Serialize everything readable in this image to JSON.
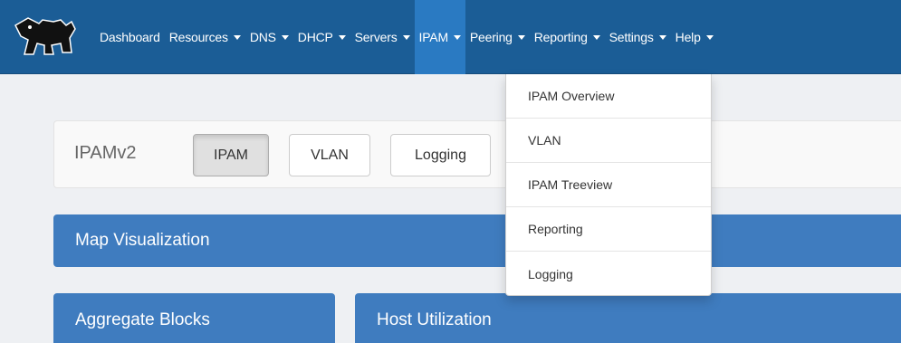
{
  "nav": {
    "items": [
      {
        "label": "Dashboard",
        "dropdown": false
      },
      {
        "label": "Resources",
        "dropdown": true
      },
      {
        "label": "DNS",
        "dropdown": true
      },
      {
        "label": "DHCP",
        "dropdown": true
      },
      {
        "label": "Servers",
        "dropdown": true
      },
      {
        "label": "IPAM",
        "dropdown": true,
        "active": true
      },
      {
        "label": "Peering",
        "dropdown": true
      },
      {
        "label": "Reporting",
        "dropdown": true
      },
      {
        "label": "Settings",
        "dropdown": true
      },
      {
        "label": "Help",
        "dropdown": true
      }
    ]
  },
  "subnav": {
    "title": "IPAMv2",
    "buttons": [
      "IPAM",
      "VLAN",
      "Logging"
    ]
  },
  "panels": {
    "map": "Map Visualization",
    "aggregate": "Aggregate Blocks",
    "host": "Host Utilization"
  },
  "ipam_menu": {
    "items": [
      "IPAM Overview",
      "VLAN",
      "IPAM Treeview",
      "Reporting",
      "Logging"
    ]
  },
  "colors": {
    "navbar": "#1b5d96",
    "nav_active": "#2a7ac2",
    "panel_header": "#3f7cbf"
  },
  "icons": {
    "logo": "bear-logo-icon",
    "caret": "caret-down-icon"
  }
}
